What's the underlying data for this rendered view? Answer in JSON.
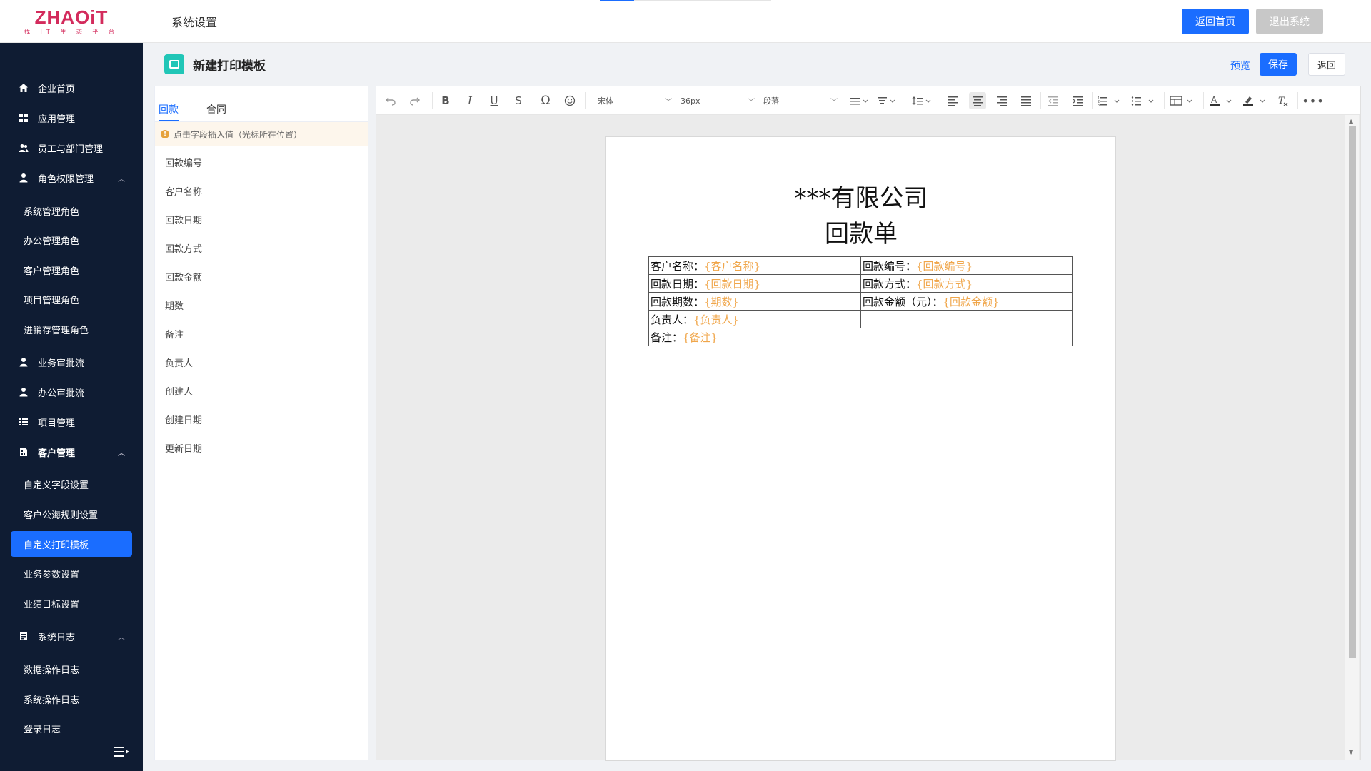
{
  "header": {
    "logo_main": "ZHAOiT",
    "logo_sub": "找 IT 生 态 平 台",
    "title": "系统设置",
    "home_button": "返回首页",
    "exit_button": "退出系统"
  },
  "sidebar": {
    "items": [
      {
        "label": "企业首页",
        "icon": "home-icon"
      },
      {
        "label": "应用管理",
        "icon": "grid-icon"
      },
      {
        "label": "员工与部门管理",
        "icon": "users-icon"
      },
      {
        "label": "角色权限管理",
        "icon": "user-icon",
        "expanded": true
      },
      {
        "label": "系统管理角色"
      },
      {
        "label": "办公管理角色"
      },
      {
        "label": "客户管理角色"
      },
      {
        "label": "项目管理角色"
      },
      {
        "label": "进销存管理角色"
      },
      {
        "label": "业务审批流",
        "icon": "user-icon"
      },
      {
        "label": "办公审批流",
        "icon": "user-icon"
      },
      {
        "label": "项目管理",
        "icon": "list-icon"
      },
      {
        "label": "客户管理",
        "icon": "building-icon",
        "expanded": true
      },
      {
        "label": "自定义字段设置"
      },
      {
        "label": "客户公海规则设置"
      },
      {
        "label": "自定义打印模板",
        "active": true
      },
      {
        "label": "业务参数设置"
      },
      {
        "label": "业绩目标设置"
      },
      {
        "label": "系统日志",
        "icon": "log-icon",
        "expanded": true
      },
      {
        "label": "数据操作日志"
      },
      {
        "label": "系统操作日志"
      },
      {
        "label": "登录日志"
      }
    ]
  },
  "page": {
    "title": "新建打印模板",
    "preview": "预览",
    "save": "保存",
    "back": "返回"
  },
  "fields_panel": {
    "tabs": [
      "回款",
      "合同"
    ],
    "active_tab": "回款",
    "tip": "点击字段插入值（光标所在位置）",
    "fields": [
      "回款编号",
      "客户名称",
      "回款日期",
      "回款方式",
      "回款金额",
      "期数",
      "备注",
      "负责人",
      "创建人",
      "创建日期",
      "更新日期"
    ]
  },
  "toolbar": {
    "font_family": "宋体",
    "font_size": "36px",
    "block_format": "段落"
  },
  "document": {
    "company": "***有限公司",
    "title": "回款单",
    "rows": [
      [
        {
          "label": "客户名称：",
          "ph": "{客户名称}"
        },
        {
          "label": "回款编号：",
          "ph": "{回款编号}"
        }
      ],
      [
        {
          "label": "回款日期：",
          "ph": "{回款日期}"
        },
        {
          "label": "回款方式：",
          "ph": "{回款方式}"
        }
      ],
      [
        {
          "label": "回款期数：",
          "ph": "{期数}"
        },
        {
          "label": "回款金额（元）：",
          "ph": "{回款金额}"
        }
      ],
      [
        {
          "label": "负责人：",
          "ph": "{负责人}"
        },
        {
          "label": "",
          "ph": ""
        }
      ],
      [
        {
          "label": "备注：",
          "ph": "{备注}"
        }
      ]
    ]
  },
  "colors": {
    "primary": "#1a6dff",
    "sidebar_bg": "#0f1c33",
    "placeholder": "#f0a64a",
    "logo": "#d32b5c"
  }
}
